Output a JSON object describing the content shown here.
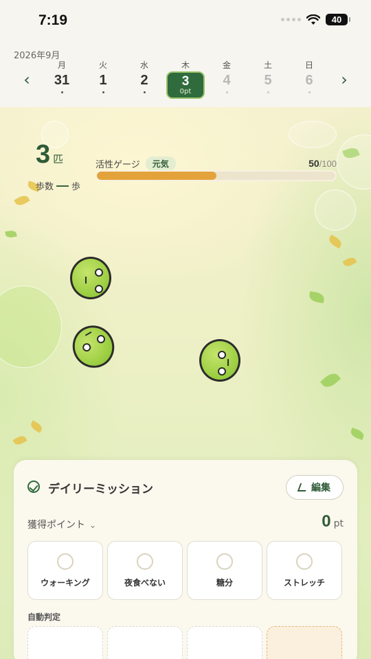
{
  "status": {
    "time": "7:19",
    "battery": "40"
  },
  "calendar": {
    "month": "2026年9月",
    "days": [
      {
        "weekday": "月",
        "num": "31"
      },
      {
        "weekday": "火",
        "num": "1"
      },
      {
        "weekday": "水",
        "num": "2"
      },
      {
        "weekday": "木",
        "num": "3",
        "pt": "0pt"
      },
      {
        "weekday": "金",
        "num": "4"
      },
      {
        "weekday": "土",
        "num": "5"
      },
      {
        "weekday": "日",
        "num": "6"
      }
    ]
  },
  "stats": {
    "count": "3",
    "count_unit": "匹",
    "steps_label": "歩数",
    "steps_value": "—",
    "steps_unit": "歩",
    "gauge_label": "活性ゲージ",
    "gauge_status": "元気",
    "gauge_current": "50",
    "gauge_max": "/100",
    "gauge_fraction": 0.5
  },
  "mission": {
    "title": "デイリーミッション",
    "edit_label": "編集",
    "points_label": "獲得ポイント",
    "points_value": "0",
    "points_unit": "pt",
    "tiles": [
      "ウォーキング",
      "夜食べない",
      "糖分",
      "ストレッチ"
    ],
    "auto_label": "自動判定"
  }
}
